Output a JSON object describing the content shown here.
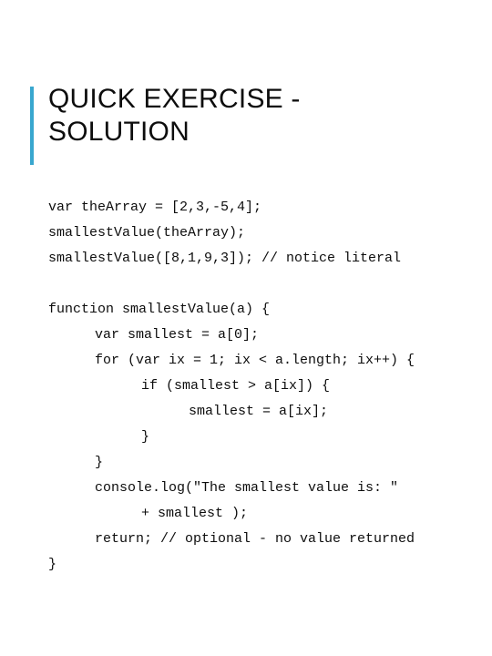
{
  "slide": {
    "background_color": "#ffffff",
    "accent_color": "#39a7cf",
    "text_color": "#0d0d0d",
    "title": "QUICK EXERCISE -\nSOLUTION",
    "code_lines": [
      {
        "indent": 0,
        "text": "var theArray = [2,3,-5,4];"
      },
      {
        "indent": 0,
        "text": "smallestValue(theArray);"
      },
      {
        "indent": 0,
        "text": "smallestValue([8,1,9,3]); // notice literal"
      },
      {
        "indent": 0,
        "text": ""
      },
      {
        "indent": 0,
        "text": "function smallestValue(a) {"
      },
      {
        "indent": 1,
        "text": "var smallest = a[0];"
      },
      {
        "indent": 1,
        "text": "for (var ix = 1; ix < a.length; ix++) {"
      },
      {
        "indent": 2,
        "text": "if (smallest > a[ix]) {"
      },
      {
        "indent": 3,
        "text": "smallest = a[ix];"
      },
      {
        "indent": 2,
        "text": "}"
      },
      {
        "indent": 1,
        "text": "}"
      },
      {
        "indent": 1,
        "text": "console.log(\"The smallest value is: \""
      },
      {
        "indent": 2,
        "text": "+ smallest );"
      },
      {
        "indent": 1,
        "text": "return; // optional - no value returned"
      },
      {
        "indent": 0,
        "text": "}"
      }
    ]
  }
}
